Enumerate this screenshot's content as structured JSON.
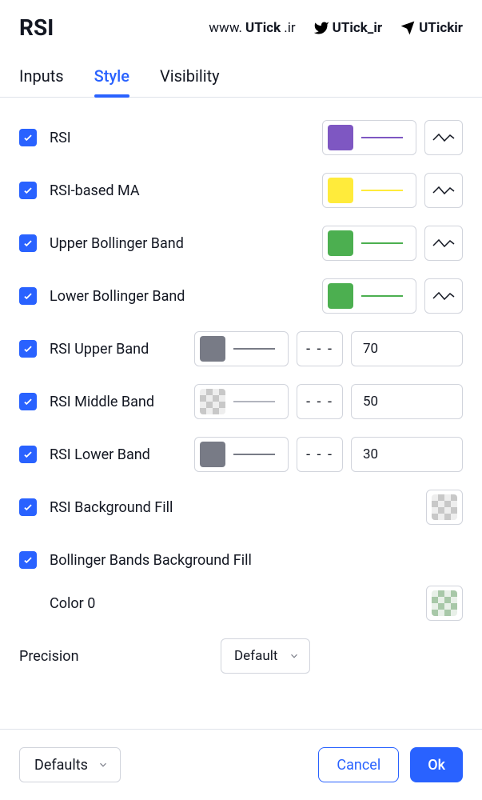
{
  "title": "RSI",
  "social": {
    "website_pre": "www.",
    "website_bold": "UTick",
    "website_post": ".ir",
    "twitter": "UTick_ir",
    "telegram": "UTickir"
  },
  "tabs": {
    "inputs": "Inputs",
    "style": "Style",
    "visibility": "Visibility"
  },
  "rows": {
    "rsi": {
      "label": "RSI",
      "color": "#7E57C2"
    },
    "rsi_ma": {
      "label": "RSI-based MA",
      "color": "#FFEB3B"
    },
    "upper_bb": {
      "label": "Upper Bollinger Band",
      "color": "#4CAF50"
    },
    "lower_bb": {
      "label": "Lower Bollinger Band",
      "color": "#4CAF50"
    },
    "rsi_upper": {
      "label": "RSI Upper Band",
      "color": "#787B86",
      "value": "70"
    },
    "rsi_middle": {
      "label": "RSI Middle Band",
      "value": "50"
    },
    "rsi_lower": {
      "label": "RSI Lower Band",
      "color": "#787B86",
      "value": "30"
    },
    "rsi_bg": {
      "label": "RSI Background Fill"
    },
    "bb_bg": {
      "label": "Bollinger Bands Background Fill"
    },
    "color0": {
      "label": "Color 0"
    }
  },
  "precision": {
    "label": "Precision",
    "value": "Default"
  },
  "footer": {
    "defaults": "Defaults",
    "cancel": "Cancel",
    "ok": "Ok"
  },
  "dash_glyph": "- - -"
}
